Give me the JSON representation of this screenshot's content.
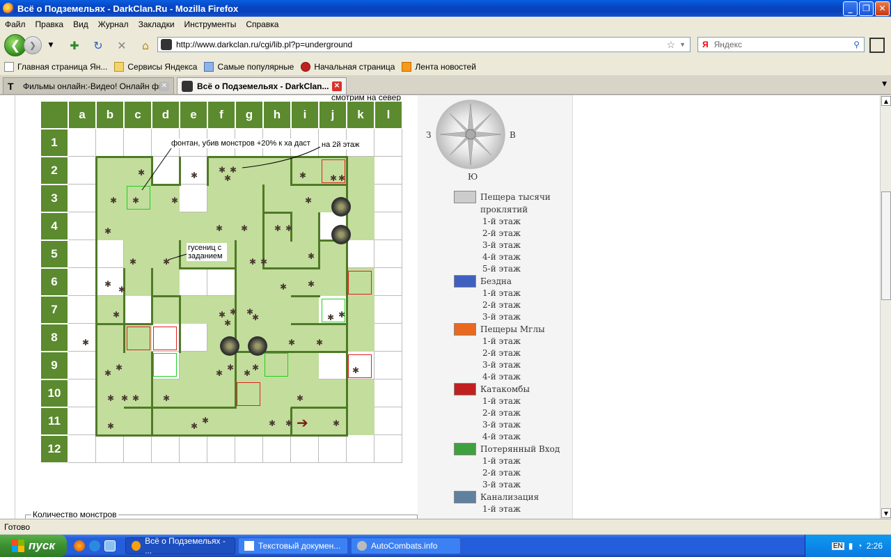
{
  "window": {
    "title": "Всё о Подземельях - DarkClan.Ru - Mozilla Firefox"
  },
  "menu": [
    "Файл",
    "Правка",
    "Вид",
    "Журнал",
    "Закладки",
    "Инструменты",
    "Справка"
  ],
  "nav": {
    "url": "http://www.darkclan.ru/cgi/lib.pl?p=underground",
    "search_placeholder": "Яндекс",
    "search_engine_icon": "Я"
  },
  "bookmarks": [
    "Главная страница Ян...",
    "Сервисы Яндекса",
    "Самые популярные",
    "Начальная страница",
    "Лента новостей"
  ],
  "tabs": [
    {
      "label": "Фильмы онлайн:-Видео! Онлайн фил...",
      "active": false
    },
    {
      "label": "Всё о Подземельях - DarkClan...",
      "active": true
    }
  ],
  "map": {
    "columns": [
      "a",
      "b",
      "c",
      "d",
      "e",
      "f",
      "g",
      "h",
      "i",
      "j",
      "k",
      "l"
    ],
    "rows": [
      "1",
      "2",
      "3",
      "4",
      "5",
      "6",
      "7",
      "8",
      "9",
      "10",
      "11",
      "12"
    ],
    "top_note": "смотрим на север",
    "notes": {
      "fountain": "фонтан, убив монстров +20% к ха даст",
      "floor2": "на 2й этаж",
      "caterpillar": "гусениц с заданием"
    }
  },
  "compass": {
    "west": "З",
    "east": "В",
    "south": "Ю"
  },
  "dungeons": [
    {
      "name": "Пещера тысячи проклятий",
      "floors": [
        "1-й этаж",
        "2-й этаж",
        "3-й этаж",
        "4-й этаж",
        "5-й этаж"
      ],
      "icon": "castle-icon"
    },
    {
      "name": "Бездна",
      "floors": [
        "1-й этаж",
        "2-й этаж",
        "3-й этаж"
      ],
      "icon": "abyss-icon"
    },
    {
      "name": "Пещеры Мглы",
      "floors": [
        "1-й этаж",
        "2-й этаж",
        "3-й этаж",
        "4-й этаж"
      ],
      "icon": "fish-icon"
    },
    {
      "name": "Катакомбы",
      "floors": [
        "1-й этаж",
        "2-й этаж",
        "3-й этаж",
        "4-й этаж"
      ],
      "icon": "catacombs-icon"
    },
    {
      "name": "Потерянный Вход",
      "floors": [
        "1-й этаж",
        "2-й этаж",
        "3-й этаж"
      ],
      "icon": "lost-entrance-icon"
    },
    {
      "name": "Канализация",
      "floors": [
        "1-й этаж"
      ],
      "icon": "sewer-icon"
    }
  ],
  "fieldset_legend": "Количество монстров",
  "status": "Готово",
  "taskbar": {
    "start": "пуск",
    "tasks": [
      "Всё о Подземельях - ...",
      "Текстовый докумен...",
      "AutoCombats.info"
    ],
    "lang": "EN",
    "time": "2:26"
  },
  "colors": {
    "map_header": "#5b8a2f",
    "map_floor": "#c3dd9d",
    "map_wall": "#4e7a25",
    "titlebar": "#0a5ee0"
  }
}
